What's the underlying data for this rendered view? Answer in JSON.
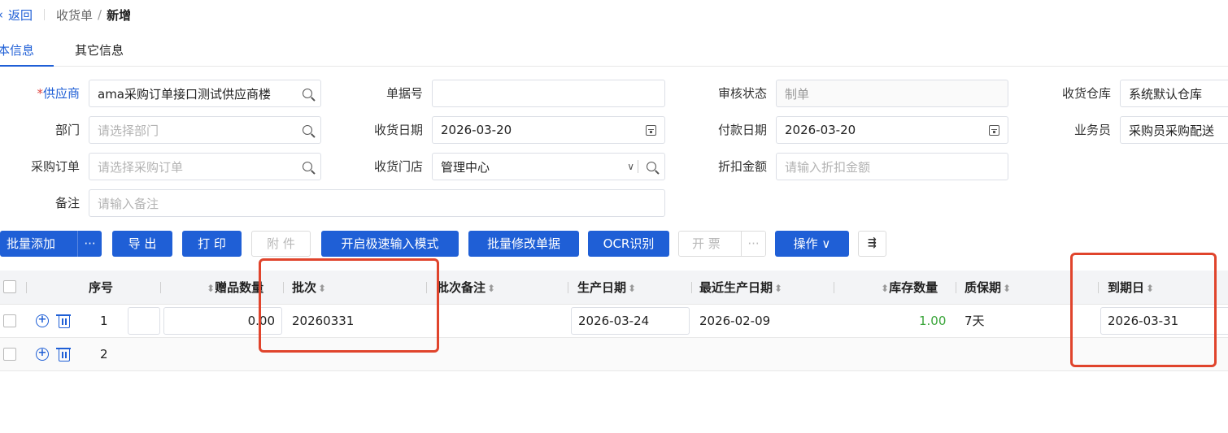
{
  "header": {
    "back_label": "返回",
    "crumb_parent": "收货单",
    "crumb_sep": "/",
    "crumb_current": "新增"
  },
  "tabs": [
    {
      "label": "基本信息",
      "active": true
    },
    {
      "label": "其它信息",
      "active": false
    }
  ],
  "form": {
    "supplier": {
      "label": "供应商",
      "required": true,
      "value": "ama采购订单接口测试供应商楼"
    },
    "doc_no": {
      "label": "单据号",
      "value": ""
    },
    "audit_status": {
      "label": "审核状态",
      "value": "制单"
    },
    "warehouse": {
      "label": "收货仓库",
      "value": "系统默认仓库"
    },
    "department": {
      "label": "部门",
      "placeholder": "请选择部门"
    },
    "receive_date": {
      "label": "收货日期",
      "value": "2026-03-20"
    },
    "pay_date": {
      "label": "付款日期",
      "value": "2026-03-20"
    },
    "salesman": {
      "label": "业务员",
      "value": "采购员采购配送"
    },
    "purchase_order": {
      "label": "采购订单",
      "placeholder": "请选择采购订单"
    },
    "receive_store": {
      "label": "收货门店",
      "value": "管理中心"
    },
    "discount": {
      "label": "折扣金额",
      "placeholder": "请输入折扣金额"
    },
    "remark": {
      "label": "备注",
      "placeholder": "请输入备注"
    }
  },
  "toolbar": {
    "batch_add": "批量添加",
    "more": "···",
    "export": "导 出",
    "print": "打 印",
    "attachment": "附 件",
    "fast_input": "开启极速输入模式",
    "batch_edit": "批量修改单据",
    "ocr": "OCR识别",
    "invoice": "开 票",
    "operate": "操作 ∨",
    "column_icon": "⇶"
  },
  "table": {
    "headers": {
      "seq": "序号",
      "gift_qty": "赠品数量",
      "batch": "批次",
      "batch_remark": "批次备注",
      "prod_date": "生产日期",
      "recent_prod_date": "最近生产日期",
      "stock_qty": "库存数量",
      "shelf_life": "质保期",
      "expire_date": "到期日"
    },
    "sort_glyph": "⬍",
    "rows": [
      {
        "seq": "1",
        "gift_qty": "0.00",
        "batch": "20260331",
        "prod_date": "2026-03-24",
        "recent_prod_date": "2026-02-09",
        "stock_qty": "1.00",
        "shelf_life": "7天",
        "expire_date": "2026-03-31"
      },
      {
        "seq": "2",
        "gift_qty": "",
        "batch": "",
        "prod_date": "",
        "recent_prod_date": "",
        "stock_qty": "",
        "shelf_life": "",
        "expire_date": ""
      }
    ]
  },
  "colors": {
    "primary": "#1f5fd6",
    "highlight": "#e0442c",
    "stock_green": "#3aa53a"
  }
}
